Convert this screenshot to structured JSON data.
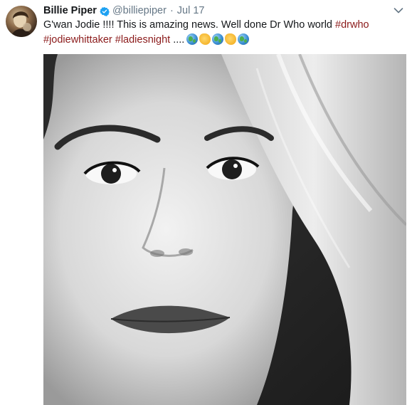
{
  "tweet": {
    "author": {
      "display_name": "Billie Piper",
      "handle": "@billiepiper",
      "verified": true
    },
    "separator": "·",
    "timestamp": "Jul 17",
    "text": {
      "line1_plain": "G'wan Jodie !!!! This is amazing news. Well done Dr Who world ",
      "hashtag_drwho": "#drwho",
      "hashtag_jodiewhittaker": "#jodiewhittaker",
      "hashtag_ladiesnight": "#ladiesnight",
      "ellipsis": " ...."
    },
    "emojis": [
      "globe-emoji",
      "clap-emoji",
      "globe-emoji",
      "clap-emoji",
      "globe-emoji"
    ],
    "media": {
      "icon": "photo",
      "style": "black-and-white portrait"
    },
    "colors": {
      "hashtag": "#8b1a1a",
      "secondary_text": "#657786",
      "verified_badge": "#1da1f2"
    }
  }
}
